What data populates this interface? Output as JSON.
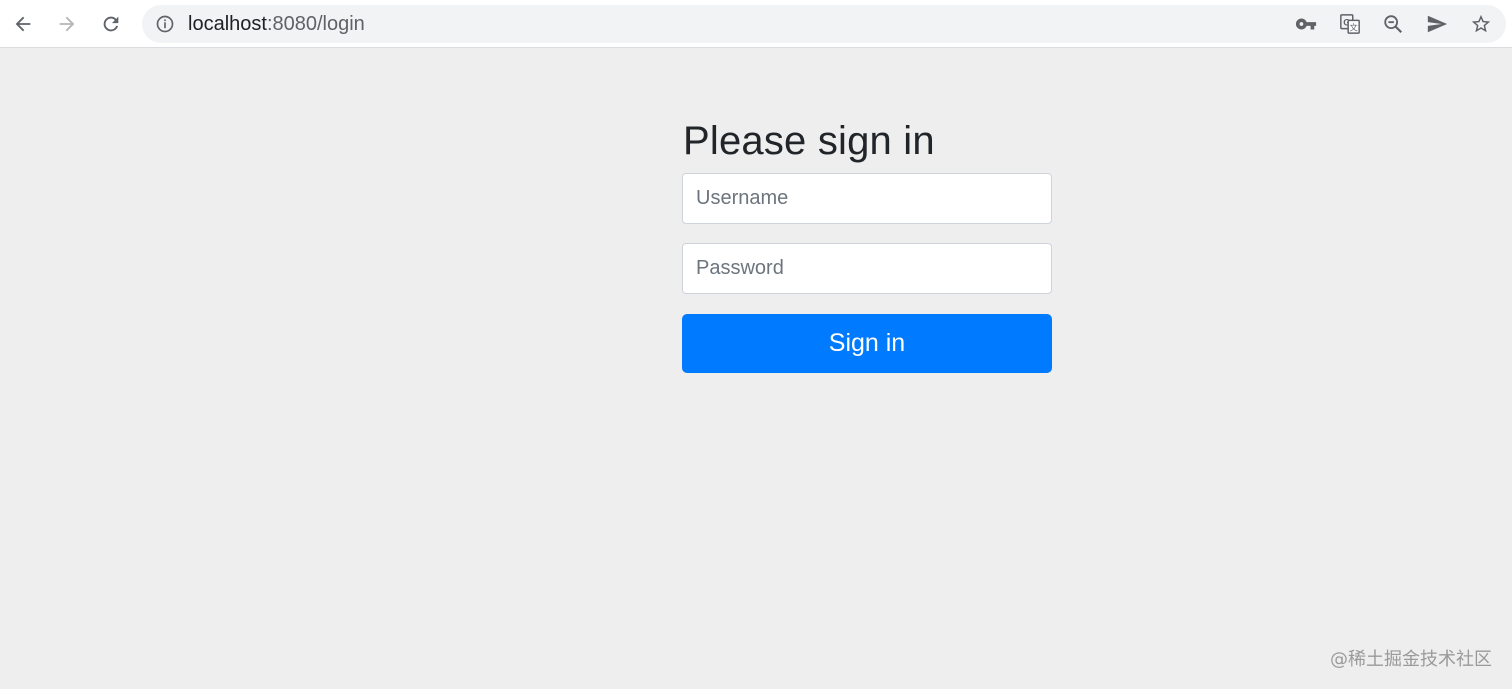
{
  "browser": {
    "url_host": "localhost",
    "url_path": ":8080/login",
    "icons": [
      "back-icon",
      "forward-icon",
      "reload-icon",
      "info-icon",
      "key-icon",
      "translate-icon",
      "zoom-out-icon",
      "send-icon",
      "star-icon"
    ]
  },
  "login": {
    "heading": "Please sign in",
    "username_placeholder": "Username",
    "username_value": "",
    "password_placeholder": "Password",
    "password_value": "",
    "submit_label": "Sign in"
  },
  "watermark": "@稀土掘金技术社区",
  "colors": {
    "page_bg": "#eeeeee",
    "primary": "#007bff",
    "heading": "#212529"
  }
}
